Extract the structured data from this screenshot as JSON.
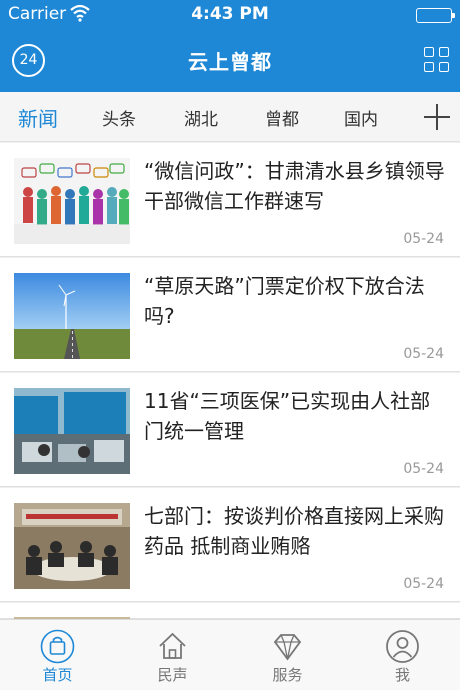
{
  "status_bar": {
    "carrier": "Carrier",
    "time": "4:43 PM"
  },
  "header": {
    "logo_text": "24",
    "title": "云上曾都"
  },
  "tabs": [
    {
      "label": "新闻",
      "active": true
    },
    {
      "label": "头条"
    },
    {
      "label": "湖北"
    },
    {
      "label": "曾都"
    },
    {
      "label": "国内"
    }
  ],
  "news": [
    {
      "title": "“微信问政”：甘肃清水县乡镇领导干部微信工作群速写",
      "date": "05-24",
      "image": "group-of-people-speech-bubbles"
    },
    {
      "title": "“草原天路”门票定价权下放合法吗?",
      "date": "05-24",
      "image": "grassland-road-wind-turbine"
    },
    {
      "title": "11省“三项医保”已实现由人社部门统一管理",
      "date": "05-24",
      "image": "medical-insurance-office"
    },
    {
      "title": "七部门：按谈判价格直接网上采购药品 抵制商业贿赂",
      "date": "05-24",
      "image": "meeting-room-conference"
    }
  ],
  "bottom_nav": [
    {
      "label": "首页",
      "icon": "bag-icon",
      "active": true
    },
    {
      "label": "民声",
      "icon": "house-icon"
    },
    {
      "label": "服务",
      "icon": "diamond-icon"
    },
    {
      "label": "我",
      "icon": "person-icon"
    }
  ],
  "colors": {
    "brand": "#1e88d6",
    "text": "#222222",
    "muted": "#999999"
  }
}
